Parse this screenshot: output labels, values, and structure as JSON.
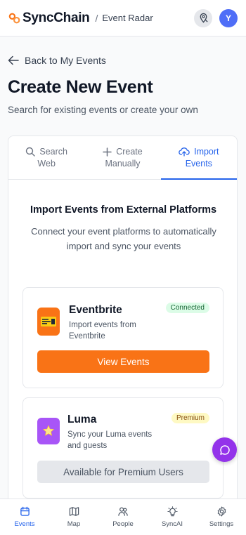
{
  "header": {
    "brand": "SyncChain",
    "separator": "/",
    "section": "Event Radar",
    "avatar_initial": "Y"
  },
  "page": {
    "back_label": "Back to My Events",
    "title": "Create New Event",
    "subtitle": "Search for existing events or create your own"
  },
  "tabs": [
    {
      "line1": "Search",
      "line2": "Web",
      "icon": "search-icon"
    },
    {
      "line1": "Create",
      "line2": "Manually",
      "icon": "plus-icon"
    },
    {
      "line1": "Import",
      "line2": "Events",
      "icon": "cloud-upload-icon",
      "active": true
    }
  ],
  "import": {
    "title": "Import Events from External Platforms",
    "description": "Connect your event platforms to automatically import and sync your events"
  },
  "platforms": {
    "eventbrite": {
      "name": "Eventbrite",
      "description": "Import events from Eventbrite",
      "badge": "Connected",
      "button": "View Events"
    },
    "luma": {
      "name": "Luma",
      "description": "Sync your Luma events and guests",
      "badge": "Premium",
      "button": "Available for Premium Users"
    }
  },
  "nav": [
    {
      "label": "Events",
      "icon": "calendar-icon",
      "active": true
    },
    {
      "label": "Map",
      "icon": "map-icon"
    },
    {
      "label": "People",
      "icon": "people-icon"
    },
    {
      "label": "SyncAI",
      "icon": "lightbulb-icon"
    },
    {
      "label": "Settings",
      "icon": "gear-icon"
    }
  ],
  "colors": {
    "accent": "#2563eb",
    "eventbrite": "#f97316",
    "luma": "#a855f7",
    "fab": "#9333ea"
  }
}
